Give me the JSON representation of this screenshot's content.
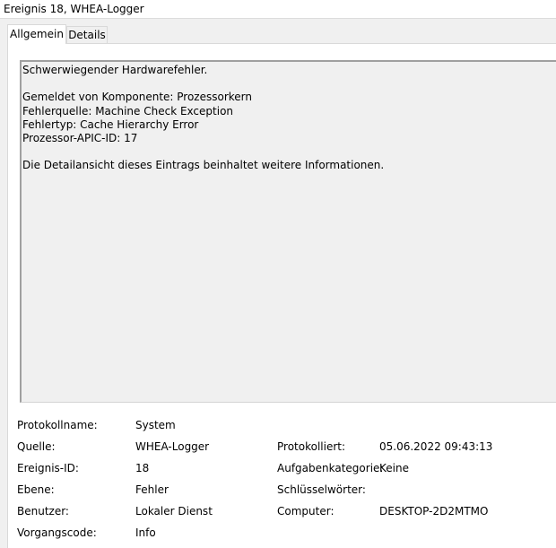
{
  "window": {
    "title": "Ereignis 18, WHEA-Logger"
  },
  "tabs": [
    {
      "label": "Allgemein",
      "active": true
    },
    {
      "label": "Details",
      "active": false
    }
  ],
  "message": {
    "lines": [
      "Schwerwiegender Hardwarefehler.",
      "",
      "Gemeldet von Komponente: Prozessorkern",
      "Fehlerquelle: Machine Check Exception",
      "Fehlertyp: Cache Hierarchy Error",
      "Prozessor-APIC-ID: 17",
      "",
      "Die Detailansicht dieses Eintrags beinhaltet weitere Informationen."
    ]
  },
  "properties": {
    "protokollname": {
      "label": "Protokollname:",
      "value": "System"
    },
    "quelle": {
      "label": "Quelle:",
      "value": "WHEA-Logger"
    },
    "protokolliert": {
      "label": "Protokolliert:",
      "value": "05.06.2022 09:43:13"
    },
    "ereignis_id": {
      "label": "Ereignis-ID:",
      "value": "18"
    },
    "aufgabenkategorie": {
      "label": "Aufgabenkategorie:",
      "value": "Keine"
    },
    "ebene": {
      "label": "Ebene:",
      "value": "Fehler"
    },
    "schluesselwoerter": {
      "label": "Schlüsselwörter:",
      "value": ""
    },
    "benutzer": {
      "label": "Benutzer:",
      "value": "Lokaler Dienst"
    },
    "computer": {
      "label": "Computer:",
      "value": "DESKTOP-2D2MTMO"
    },
    "vorgangscode": {
      "label": "Vorgangscode:",
      "value": "Info"
    }
  }
}
